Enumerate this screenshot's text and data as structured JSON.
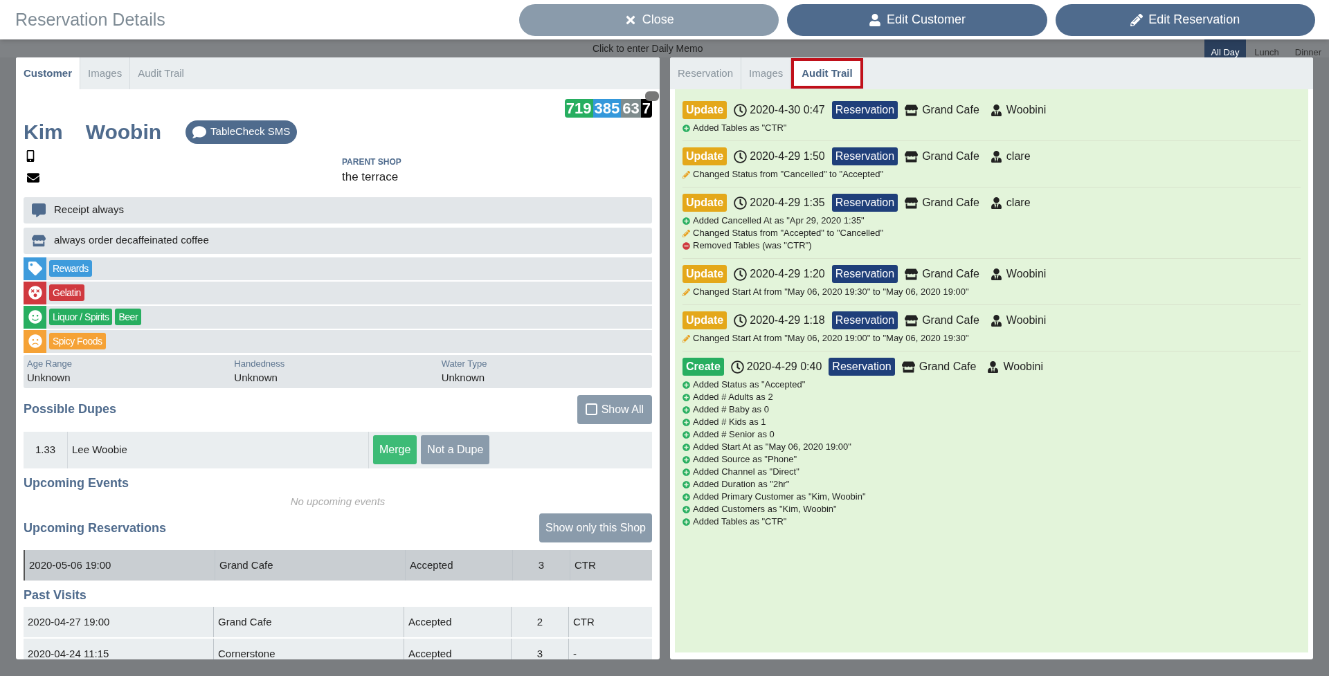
{
  "header": {
    "title": "Reservation Details",
    "buttons": [
      {
        "label": "Close",
        "kind": "close"
      },
      {
        "label": "Edit Customer",
        "kind": "customer"
      },
      {
        "label": "Edit Reservation",
        "kind": "edit"
      }
    ]
  },
  "backdrop": {
    "memo": "Click to enter Daily Memo",
    "periods": [
      {
        "label": "All Day",
        "selected": true
      },
      {
        "label": "Lunch",
        "selected": false
      },
      {
        "label": "Dinner",
        "selected": false
      }
    ]
  },
  "customer_panel": {
    "tabs": [
      {
        "label": "Customer",
        "selected": true
      },
      {
        "label": "Images",
        "selected": false
      },
      {
        "label": "Audit Trail",
        "selected": false
      }
    ],
    "scores": [
      {
        "value": "719",
        "color": "#27ae60"
      },
      {
        "value": "385",
        "color": "#3498db"
      },
      {
        "value": "63",
        "color": "#7f8c8d"
      },
      {
        "value": "7",
        "color": "#000000"
      }
    ],
    "first_name": "Kim",
    "last_name": "Woobin",
    "sms_button": "TableCheck SMS",
    "parent_shop": {
      "label": "PARENT SHOP",
      "value": "the terrace"
    },
    "notes": [
      {
        "kind": "comment",
        "text": "Receipt always"
      },
      {
        "kind": "shop",
        "text": "always order decaffeinated coffee"
      }
    ],
    "tag_rows": [
      {
        "kind": "tag",
        "color": "#3e9bdc",
        "tags": [
          "Rewards"
        ]
      },
      {
        "kind": "dislike",
        "color": "#d0393f",
        "tags": [
          "Gelatin"
        ]
      },
      {
        "kind": "like",
        "color": "#27ae60",
        "tags": [
          "Liquor / Spirits",
          "Beer"
        ]
      },
      {
        "kind": "meh",
        "color": "#f5a236",
        "tags": [
          "Spicy Foods"
        ]
      }
    ],
    "attributes": [
      {
        "label": "Age Range",
        "value": "Unknown"
      },
      {
        "label": "Handedness",
        "value": "Unknown"
      },
      {
        "label": "Water Type",
        "value": "Unknown"
      }
    ],
    "dupes": {
      "title": "Possible Dupes",
      "show_all": {
        "label": "Show All",
        "checked": false
      },
      "rows": [
        {
          "score": "1.33",
          "name": "Lee Woobie",
          "merge": "Merge",
          "not_dupe": "Not a Dupe"
        }
      ]
    },
    "upcoming_events": {
      "title": "Upcoming Events",
      "empty": "No upcoming events"
    },
    "upcoming_reservations": {
      "title": "Upcoming Reservations",
      "filter_button": "Show only this Shop",
      "rows": [
        {
          "selected": true,
          "cells": [
            "2020-05-06 19:00",
            "Grand Cafe",
            "Accepted",
            "3",
            "CTR"
          ]
        }
      ]
    },
    "past_visits": {
      "title": "Past Visits",
      "rows": [
        {
          "selected": false,
          "cells": [
            "2020-04-27 19:00",
            "Grand Cafe",
            "Accepted",
            "2",
            "CTR"
          ]
        },
        {
          "selected": false,
          "cells": [
            "2020-04-24 11:15",
            "Cornerstone",
            "Accepted",
            "3",
            "-"
          ]
        }
      ]
    }
  },
  "reservation_panel": {
    "tabs": [
      {
        "label": "Reservation",
        "selected": false
      },
      {
        "label": "Images",
        "selected": false
      },
      {
        "label": "Audit Trail",
        "selected": true
      }
    ],
    "entries": [
      {
        "action": "Update",
        "kind": "update",
        "time": "2020-4-30 0:47",
        "type": "Reservation",
        "shop": "Grand Cafe",
        "user": "Woobini",
        "changes": [
          {
            "kind": "added",
            "text": "Added Tables as \"CTR\""
          }
        ]
      },
      {
        "action": "Update",
        "kind": "update",
        "time": "2020-4-29 1:50",
        "type": "Reservation",
        "shop": "Grand Cafe",
        "user": "clare",
        "changes": [
          {
            "kind": "changed",
            "text": "Changed Status from \"Cancelled\" to \"Accepted\""
          }
        ]
      },
      {
        "action": "Update",
        "kind": "update",
        "time": "2020-4-29 1:35",
        "type": "Reservation",
        "shop": "Grand Cafe",
        "user": "clare",
        "changes": [
          {
            "kind": "added",
            "text": "Added Cancelled At as \"Apr 29, 2020 1:35\""
          },
          {
            "kind": "changed",
            "text": "Changed Status from \"Accepted\" to \"Cancelled\""
          },
          {
            "kind": "removed",
            "text": "Removed Tables (was \"CTR\")"
          }
        ]
      },
      {
        "action": "Update",
        "kind": "update",
        "time": "2020-4-29 1:20",
        "type": "Reservation",
        "shop": "Grand Cafe",
        "user": "Woobini",
        "changes": [
          {
            "kind": "changed",
            "text": "Changed Start At from \"May 06, 2020 19:30\" to \"May 06, 2020 19:00\""
          }
        ]
      },
      {
        "action": "Update",
        "kind": "update",
        "time": "2020-4-29 1:18",
        "type": "Reservation",
        "shop": "Grand Cafe",
        "user": "Woobini",
        "changes": [
          {
            "kind": "changed",
            "text": "Changed Start At from \"May 06, 2020 19:00\" to \"May 06, 2020 19:30\""
          }
        ]
      },
      {
        "action": "Create",
        "kind": "create",
        "time": "2020-4-29 0:40",
        "type": "Reservation",
        "shop": "Grand Cafe",
        "user": "Woobini",
        "changes": [
          {
            "kind": "added",
            "text": "Added Status as \"Accepted\""
          },
          {
            "kind": "added",
            "text": "Added # Adults as 2"
          },
          {
            "kind": "added",
            "text": "Added # Baby as 0"
          },
          {
            "kind": "added",
            "text": "Added # Kids as 1"
          },
          {
            "kind": "added",
            "text": "Added # Senior as 0"
          },
          {
            "kind": "added",
            "text": "Added Start At as \"May 06, 2020 19:00\""
          },
          {
            "kind": "added",
            "text": "Added Source as \"Phone\""
          },
          {
            "kind": "added",
            "text": "Added Channel as \"Direct\""
          },
          {
            "kind": "added",
            "text": "Added Duration as \"2hr\""
          },
          {
            "kind": "added",
            "text": "Added Primary Customer as \"Kim, Woobin\""
          },
          {
            "kind": "added",
            "text": "Added Customers as \"Kim, Woobin\""
          },
          {
            "kind": "added",
            "text": "Added Tables as \"CTR\""
          }
        ]
      }
    ]
  }
}
